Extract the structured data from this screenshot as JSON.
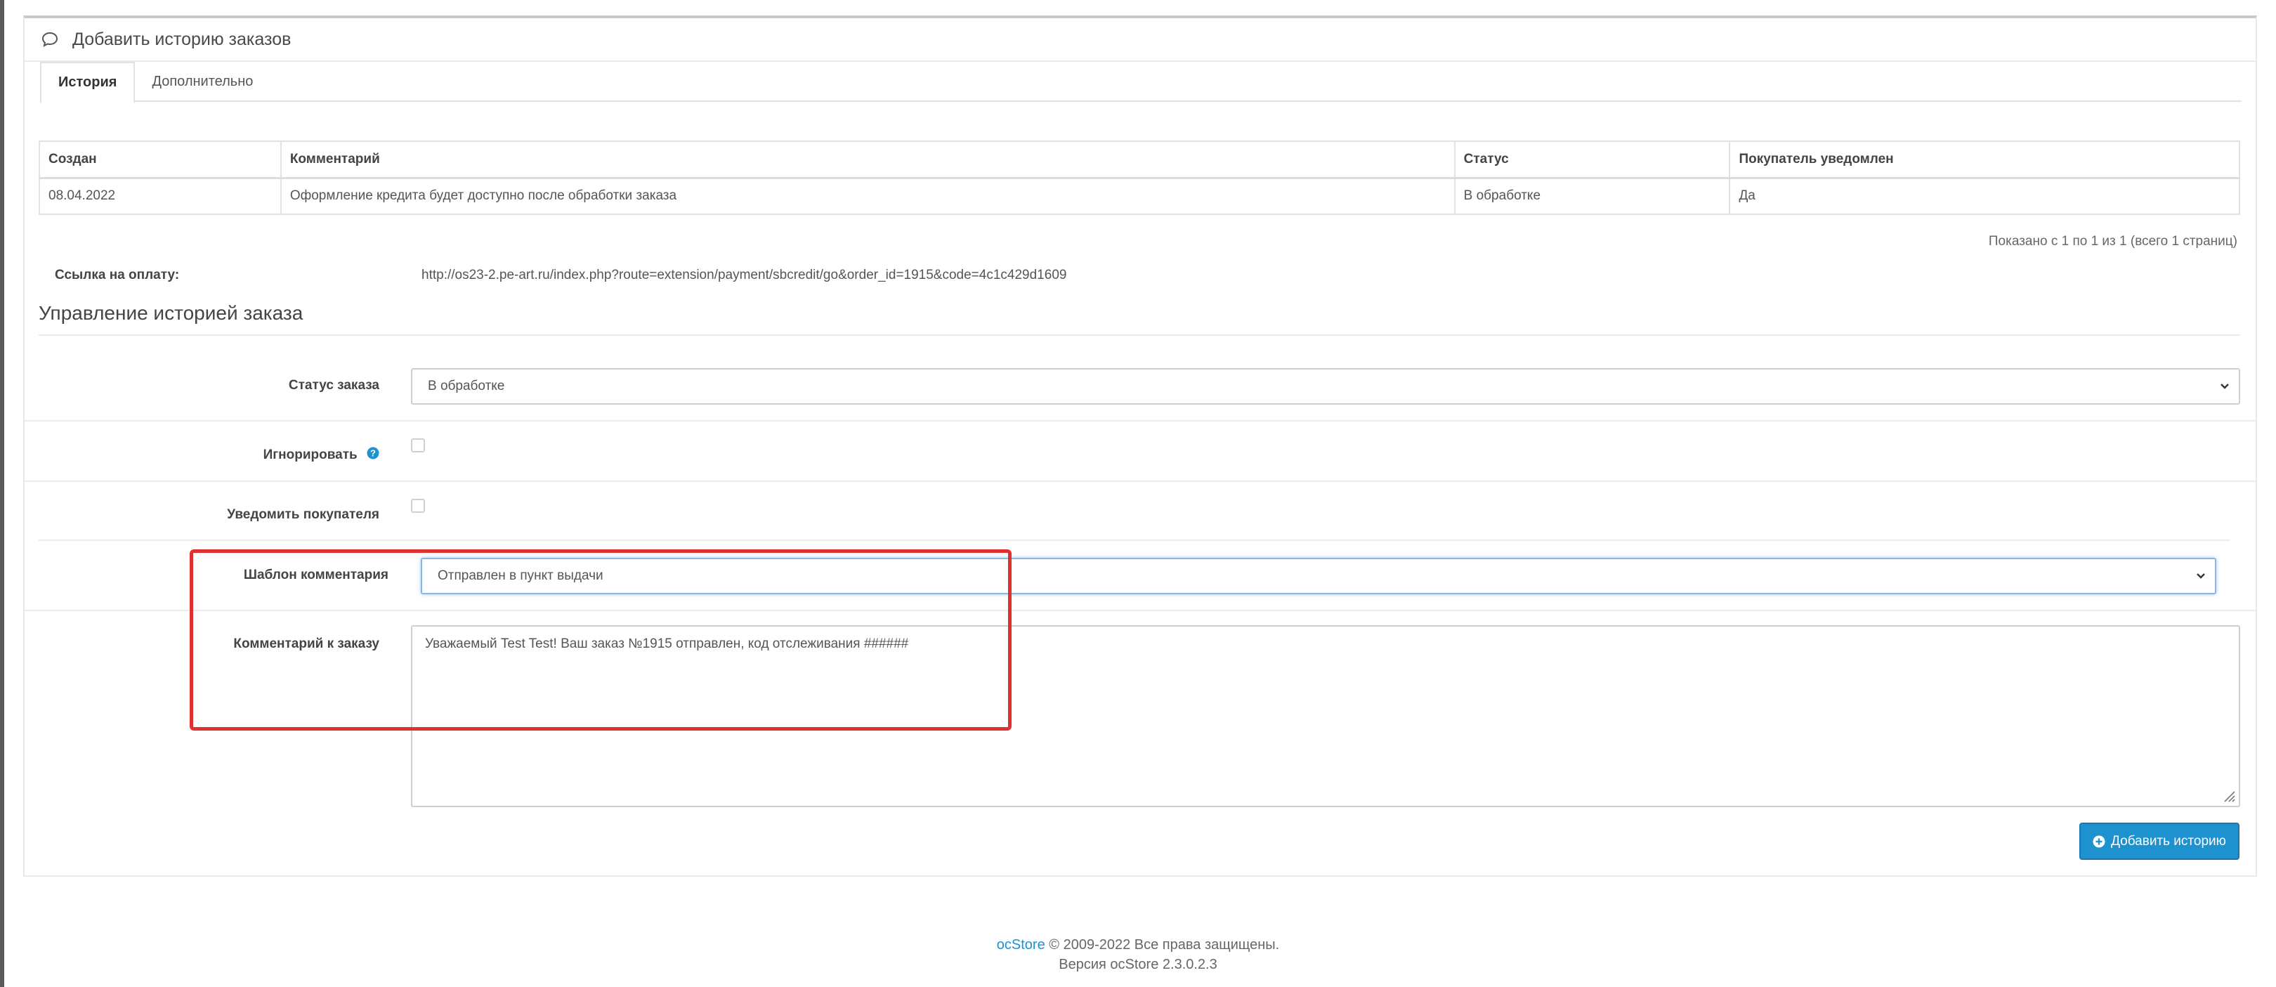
{
  "panel": {
    "title": "Добавить историю заказов",
    "icon": "comment-icon"
  },
  "tabs": [
    {
      "label": "История",
      "active": true
    },
    {
      "label": "Дополнительно",
      "active": false
    }
  ],
  "history_table": {
    "headers": [
      "Создан",
      "Комментарий",
      "Статус",
      "Покупатель уведомлен"
    ],
    "rows": [
      [
        "08.04.2022",
        "Оформление кредита будет доступно после обработки заказа",
        "В обработке",
        "Да"
      ]
    ]
  },
  "pagination_info": "Показано с 1 по 1 из 1 (всего 1 страниц)",
  "payment_link": {
    "label": "Ссылка на оплату:",
    "value": "http://os23-2.pe-art.ru/index.php?route=extension/payment/sbcredit/go&order_id=1915&code=4c1c429d1609"
  },
  "section_title": "Управление историей заказа",
  "form": {
    "status_label": "Статус заказа",
    "status_value": "В обработке",
    "ignore_label": "Игнорировать",
    "notify_label": "Уведомить покупателя",
    "template_label": "Шаблон комментария",
    "template_value": "Отправлен в пункт выдачи",
    "comment_label": "Комментарий к заказу",
    "comment_value": "Уважаемый Test Test! Ваш заказ №1915 отправлен, код отслеживания ######"
  },
  "add_button": "Добавить историю",
  "footer": {
    "brand": "ocStore",
    "copyright": "© 2009-2022 Все права защищены.",
    "version": "Версия ocStore 2.3.0.2.3"
  },
  "colors": {
    "accent": "#1e91cf",
    "highlight": "#e03131"
  }
}
